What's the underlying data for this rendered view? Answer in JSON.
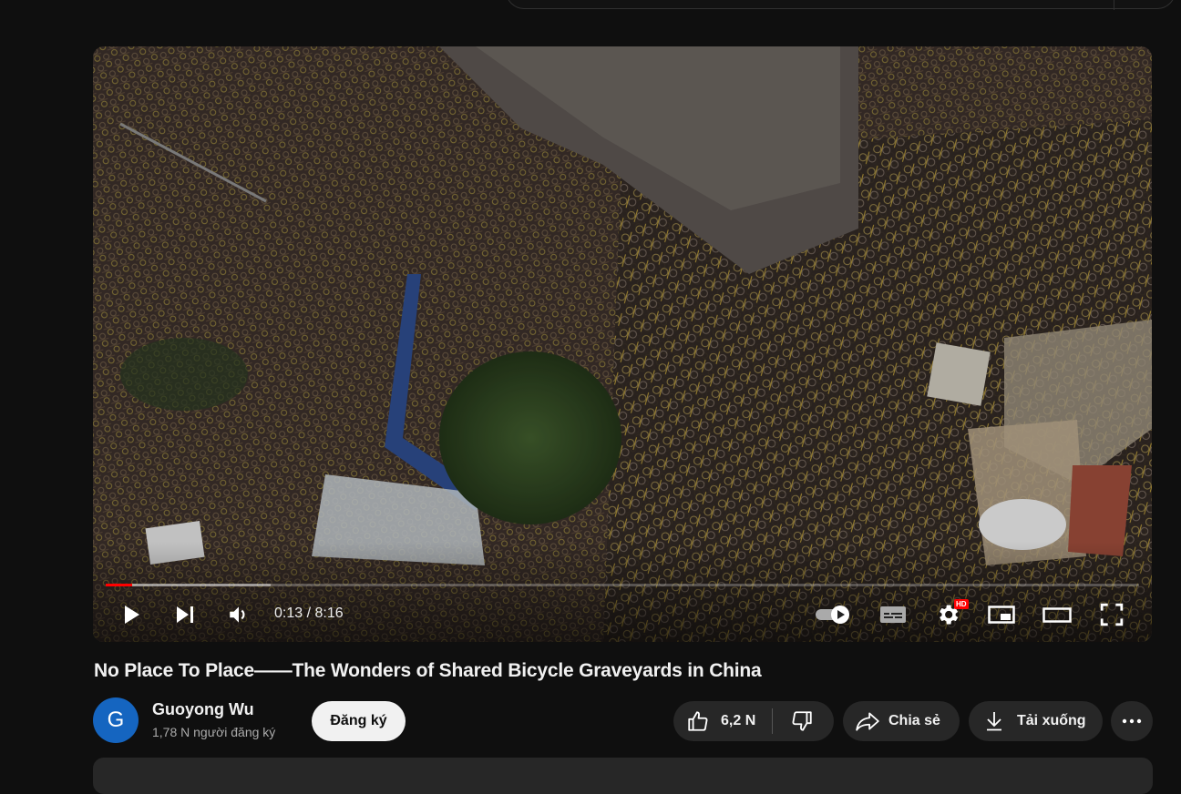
{
  "player": {
    "current_time": "0:13",
    "duration": "8:16",
    "time_display": "0:13 / 8:16",
    "progress_fraction": 0.026,
    "buffered_fraction": 0.16,
    "autoplay_on": true,
    "quality_badge": "HD",
    "accent_color": "#ff0000"
  },
  "video": {
    "title": "No Place To Place——The Wonders of Shared Bicycle Graveyards in China"
  },
  "channel": {
    "avatar_letter": "G",
    "avatar_color": "#1565c0",
    "name": "Guoyong Wu",
    "subscribers": "1,78 N người đăng ký"
  },
  "actions": {
    "subscribe_label": "Đăng ký",
    "like_count": "6,2 N",
    "share_label": "Chia sẻ",
    "download_label": "Tải xuống"
  },
  "icons": {
    "play": "play-icon",
    "next": "next-icon",
    "volume": "volume-icon",
    "autoplay": "autoplay-toggle-icon",
    "captions": "captions-icon",
    "settings": "gear-icon",
    "miniplayer": "miniplayer-icon",
    "theater": "theater-icon",
    "fullscreen": "fullscreen-icon",
    "like": "thumbs-up-icon",
    "dislike": "thumbs-down-icon",
    "share": "share-arrow-icon",
    "download": "download-icon",
    "more": "more-horizontal-icon"
  }
}
